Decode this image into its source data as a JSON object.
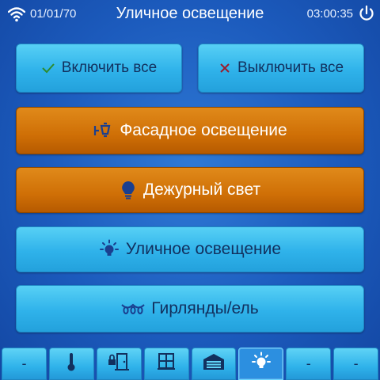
{
  "status": {
    "date": "01/01/70",
    "title": "Уличное освещение",
    "time": "03:00:35",
    "wifi_icon": "wifi-icon",
    "power_icon": "power-icon"
  },
  "actions": {
    "all_on": {
      "label": "Включить все",
      "icon": "check-icon"
    },
    "all_off": {
      "label": "Выключить все",
      "icon": "x-icon"
    }
  },
  "lights": [
    {
      "label": "Фасадное освещение",
      "icon": "facade-lamp-icon",
      "state": "on"
    },
    {
      "label": "Дежурный свет",
      "icon": "bulb-icon",
      "state": "on"
    },
    {
      "label": "Уличное освещение",
      "icon": "street-lamp-icon",
      "state": "off"
    },
    {
      "label": "Гирлянды/ель",
      "icon": "garland-icon",
      "state": "off"
    }
  ],
  "nav": {
    "tabs": [
      {
        "label": "-",
        "icon": ""
      },
      {
        "label": "",
        "icon": "thermometer-icon"
      },
      {
        "label": "",
        "icon": "door-lock-icon"
      },
      {
        "label": "",
        "icon": "window-icon"
      },
      {
        "label": "",
        "icon": "garage-icon"
      },
      {
        "label": "",
        "icon": "light-icon",
        "active": true
      },
      {
        "label": "-",
        "icon": ""
      },
      {
        "label": "-",
        "icon": ""
      }
    ]
  },
  "colors": {
    "background": "#1c5bbd",
    "button_blue": "#2fb2ea",
    "button_orange": "#cf6f06",
    "icon_dark": "#1a3f8f"
  }
}
